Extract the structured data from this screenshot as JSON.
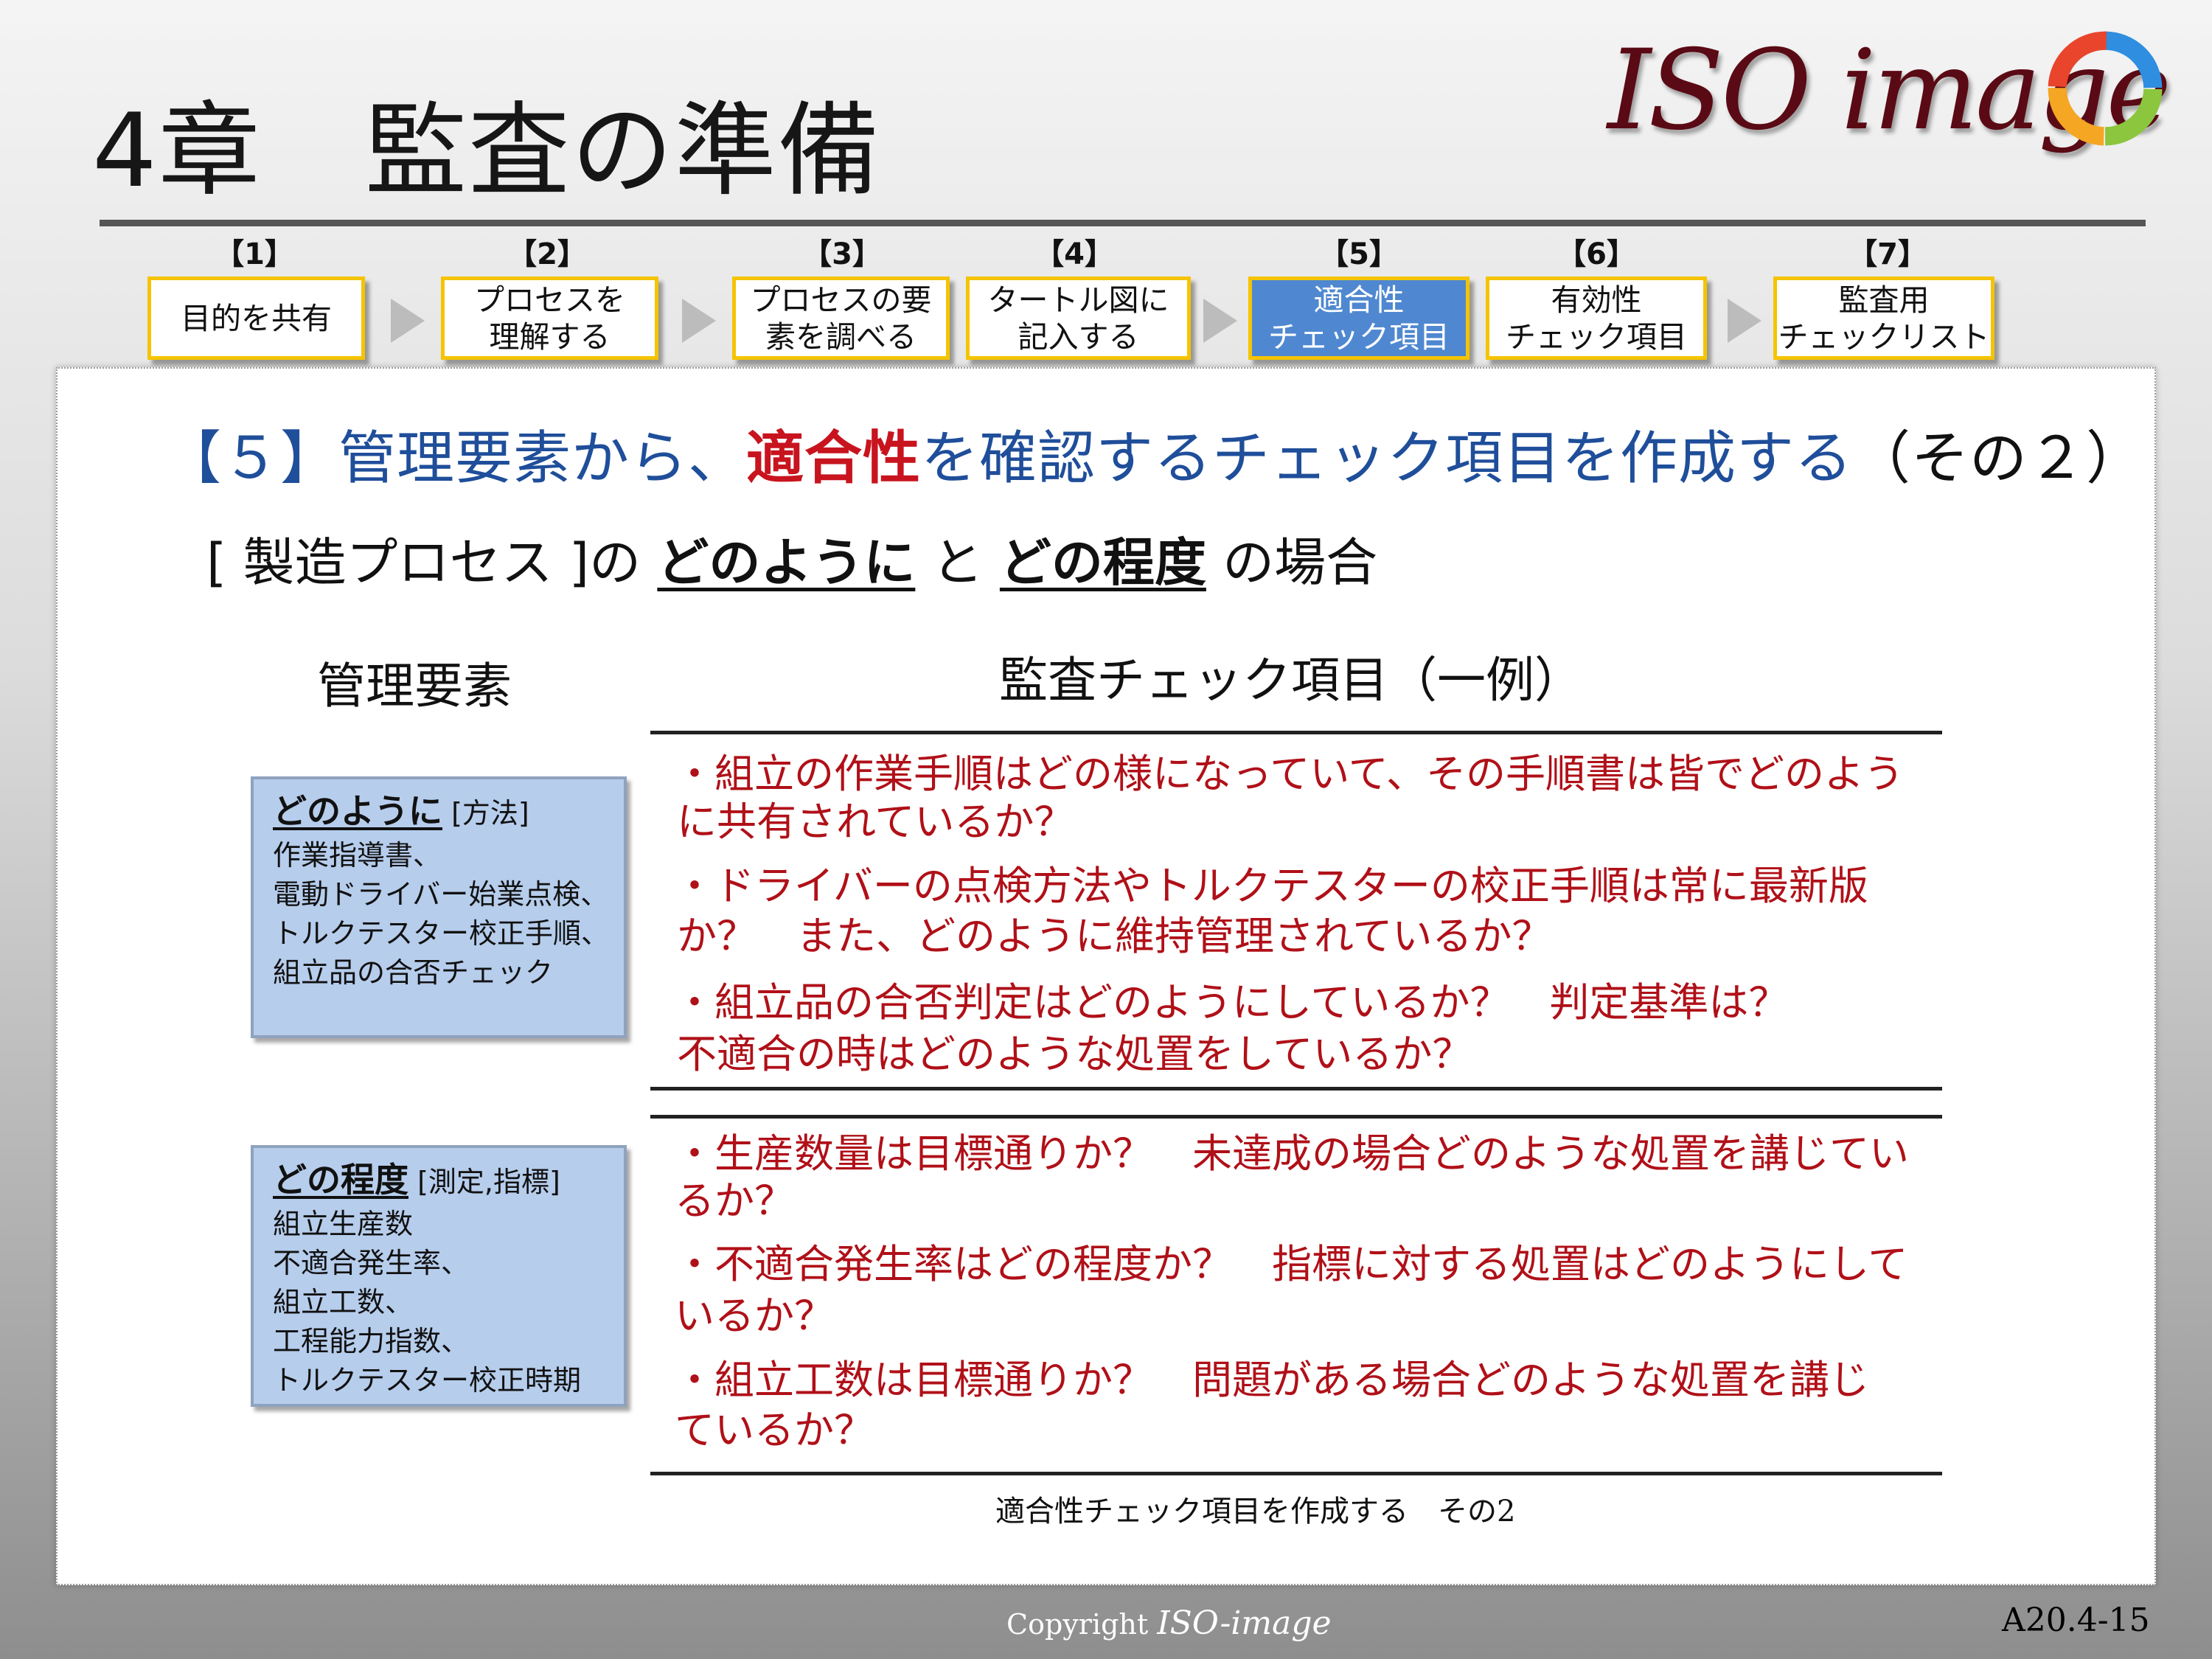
{
  "header": {
    "title": "4章　監査の準備",
    "logo_text": "ISO image"
  },
  "steps": [
    {
      "num": "【1】",
      "label": "目的を共有",
      "active": false
    },
    {
      "num": "【2】",
      "label": "プロセスを\n理解する",
      "active": false
    },
    {
      "num": "【3】",
      "label": "プロセスの要\n素を調べる",
      "active": false
    },
    {
      "num": "【4】",
      "label": "タートル図に\n記入する",
      "active": false
    },
    {
      "num": "【5】",
      "label": "適合性\nチェック項目",
      "active": true
    },
    {
      "num": "【6】",
      "label": "有効性\nチェック項目",
      "active": false
    },
    {
      "num": "【7】",
      "label": "監査用\nチェックリスト",
      "active": false
    }
  ],
  "section": {
    "heading_pre": "【５】管理要素から、",
    "heading_hl": "適合性",
    "heading_post": "を確認するチェック項目を作成する",
    "heading_tail": "（その２）",
    "sub_pre": "[ 製造プロセス ]の ",
    "sub_u1": "どのように",
    "sub_mid": " と ",
    "sub_u2": "どの程度",
    "sub_post": " の場合"
  },
  "columns": {
    "left": "管理要素",
    "right": "監査チェック項目（一例）"
  },
  "groups": [
    {
      "title": "どのように",
      "tag": " [方法]",
      "lines": [
        "作業指導書、",
        "電動ドライバー始業点検、",
        "トルクテスター校正手順、",
        "組立品の合否チェック"
      ],
      "checks": [
        "・組立の作業手順はどの様になっていて、その手順書は皆でどのよう",
        "に共有されているか？",
        "・ドライバーの点検方法やトルクテスターの校正手順は常に最新版",
        "か？　また、どのように維持管理されているか？",
        "・組立品の合否判定はどのようにしているか？　判定基準は？",
        "不適合の時はどのような処置をしているか？"
      ]
    },
    {
      "title": "どの程度",
      "tag": " [測定,指標]",
      "lines": [
        "組立生産数",
        "不適合発生率、",
        "組立工数、",
        "工程能力指数、",
        "トルクテスター校正時期"
      ],
      "checks": [
        "・生産数量は目標通りか？　未達成の場合どのような処置を講じてい",
        "るか？",
        "・不適合発生率はどの程度か？　指標に対する処置はどのようにして",
        "いるか？",
        "・組立工数は目標通りか？　問題がある場合どのような処置を講じ",
        "ているか？"
      ]
    }
  ],
  "caption": "適合性チェック項目を作成する　その2",
  "footer": {
    "copyright": "Copyright",
    "brand": "ISO-image",
    "slide_number": "A20.4-15"
  },
  "colors": {
    "step_border": "#f5c400",
    "step_active": "#4f88d0",
    "heading_blue": "#1f4e9a",
    "accent_red": "#c8141e",
    "box_blue": "#b6cdec"
  }
}
